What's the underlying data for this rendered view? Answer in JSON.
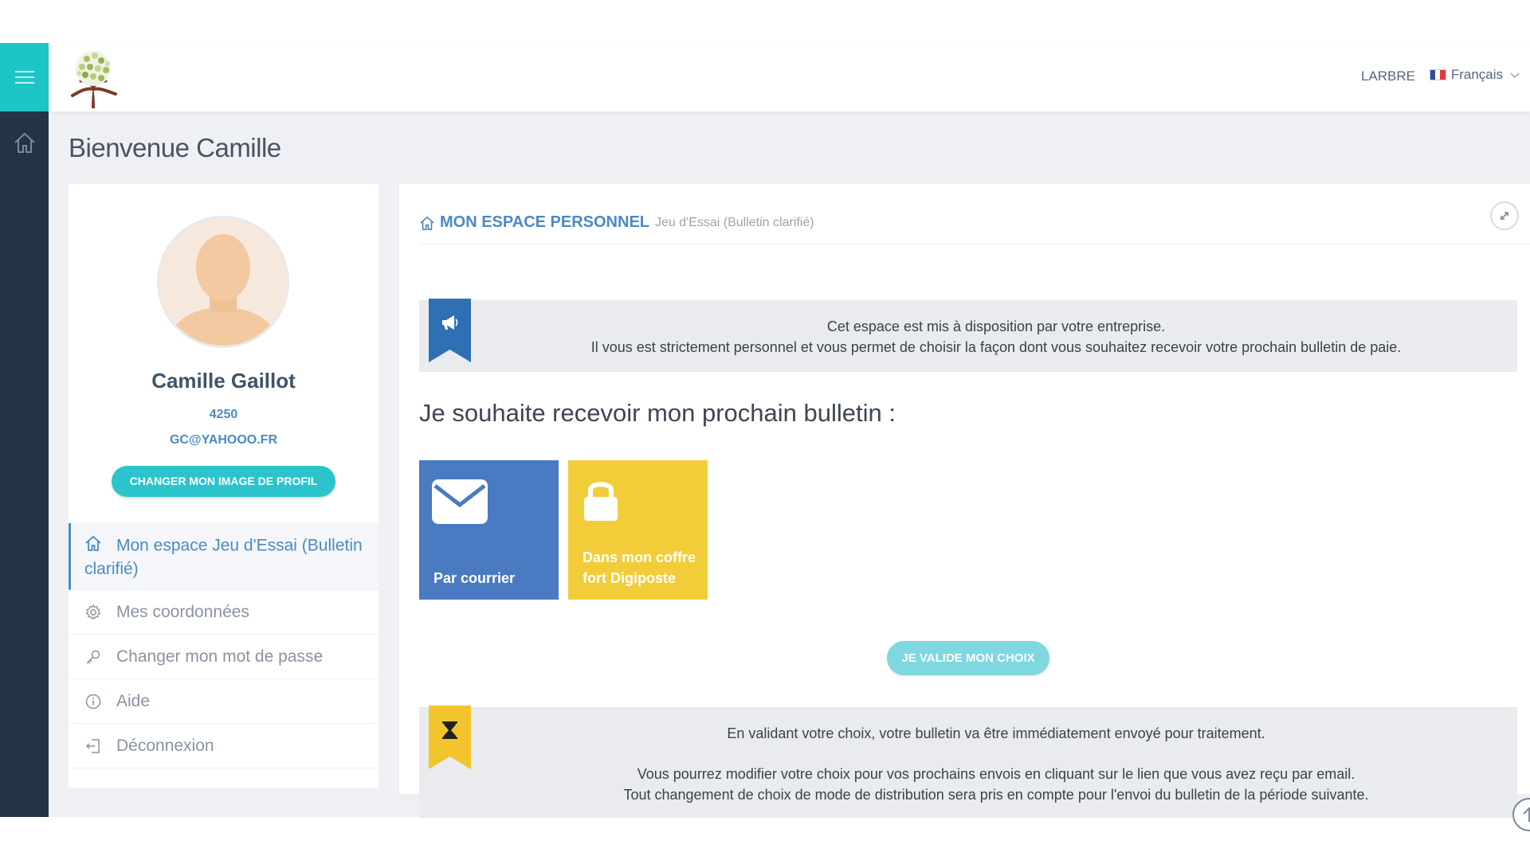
{
  "topbar": {
    "user_label": "LARBRE",
    "language_label": "Français"
  },
  "page": {
    "title": "Bienvenue Camille"
  },
  "profile": {
    "name": "Camille Gaillot",
    "id": "4250",
    "email": "GC@YAHOOO.FR",
    "change_photo_label": "CHANGER MON IMAGE DE PROFIL"
  },
  "menu": {
    "items": [
      {
        "label": "Mon espace Jeu d'Essai (Bulletin clarifié)",
        "icon": "home-icon",
        "active": true
      },
      {
        "label": "Mes coordonnées",
        "icon": "gear-icon",
        "active": false
      },
      {
        "label": "Changer mon mot de passe",
        "icon": "key-icon",
        "active": false
      },
      {
        "label": "Aide",
        "icon": "info-icon",
        "active": false
      },
      {
        "label": "Déconnexion",
        "icon": "logout-icon",
        "active": false
      }
    ]
  },
  "panel": {
    "title": "MON ESPACE PERSONNEL",
    "subtitle": "Jeu d'Essai (Bulletin clarifié)"
  },
  "notice_top": {
    "line1": "Cet espace est mis à disposition par votre entreprise.",
    "line2": "Il vous est strictement personnel et vous permet de choisir la façon dont vous souhaitez recevoir votre prochain bulletin de paie."
  },
  "choice": {
    "title": "Je souhaite recevoir mon prochain bulletin :",
    "options": [
      {
        "label": "Par courrier",
        "icon": "envelope-icon",
        "color": "#4a7ac2"
      },
      {
        "label": "Dans mon coffre fort Digiposte",
        "icon": "lock-icon",
        "color": "#f2cd39"
      }
    ],
    "validate_label": "JE VALIDE MON CHOIX"
  },
  "notice_bottom": {
    "line1": "En validant votre choix, votre bulletin va être immédiatement envoyé pour traitement.",
    "line2": "Vous pourrez modifier votre choix pour vos prochains envois en cliquant sur le lien que vous avez reçu par email.",
    "line3": "Tout changement de choix de mode de distribution sera pris en compte pour l'envoi du bulletin de la période suivante."
  },
  "colors": {
    "accent": "#1cc6c7",
    "rail": "#243347",
    "link": "#4a8ac3",
    "mail_tile": "#4a7ac2",
    "safe_tile": "#f2cd39"
  }
}
